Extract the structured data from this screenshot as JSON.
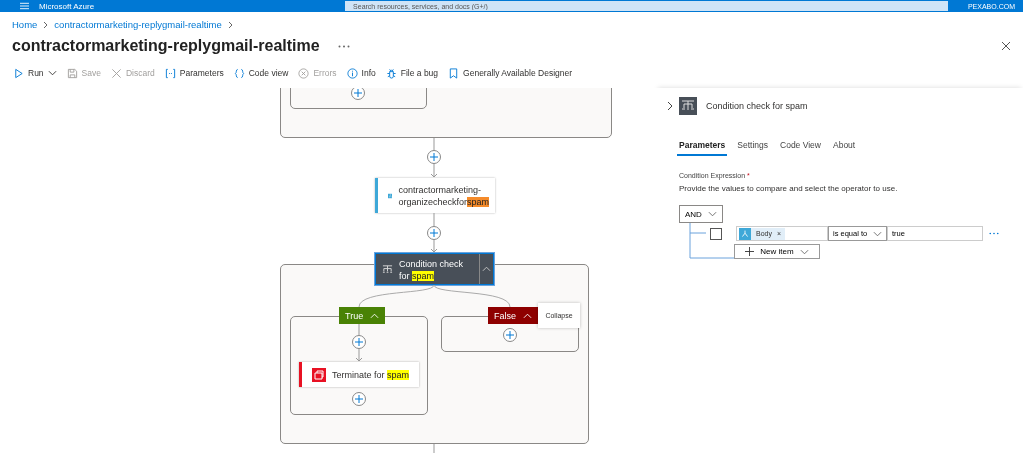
{
  "top_bar": {
    "brand": "Microsoft Azure",
    "search": {
      "placeholder": "Search resources, services, and docs (G+/)"
    },
    "account": "PEXABO.COM"
  },
  "breadcrumb": [
    {
      "label": "Home"
    },
    {
      "label": "contractormarketing-replygmail-realtime"
    }
  ],
  "title": "contractormarketing-replygmail-realtime",
  "toolbar": [
    {
      "label": "Run",
      "kind": "play",
      "disabled": false,
      "has_menu": true
    },
    {
      "label": "Save",
      "kind": "save",
      "disabled": true,
      "has_menu": false
    },
    {
      "label": "Discard",
      "kind": "discard",
      "disabled": true,
      "has_menu": false
    },
    {
      "label": "Parameters",
      "kind": "parameters",
      "disabled": false,
      "has_menu": false
    },
    {
      "label": "Code view",
      "kind": "code",
      "disabled": false,
      "has_menu": false
    },
    {
      "label": "Errors",
      "kind": "errors",
      "disabled": true,
      "has_menu": false
    },
    {
      "label": "Info",
      "kind": "info",
      "disabled": false,
      "has_menu": false
    },
    {
      "label": "File a bug",
      "kind": "bug",
      "disabled": false,
      "has_menu": false
    },
    {
      "label": "Generally Available Designer",
      "kind": "bookmark",
      "disabled": false,
      "has_menu": false
    }
  ],
  "canvas": {
    "action": {
      "text": "contractormarketing-organizecheckfor",
      "highlight": "spam",
      "match_active": true
    },
    "condition": {
      "text": "Condition check for ",
      "highlight": "spam",
      "match_active": false,
      "selected": true
    },
    "branches": [
      {
        "label": "True",
        "kind": "true",
        "expanded": true
      },
      {
        "label": "False",
        "kind": "false",
        "expanded": true
      }
    ],
    "terminate": {
      "text": "Terminate for ",
      "highlight": "spam",
      "match_active": false
    },
    "tooltip": "Collapse"
  },
  "panel": {
    "title": "Condition check for spam",
    "tabs": [
      {
        "label": "Parameters",
        "selected": true
      },
      {
        "label": "Settings",
        "selected": false
      },
      {
        "label": "Code View",
        "selected": false
      },
      {
        "label": "About",
        "selected": false
      }
    ],
    "field_label": "Condition Expression",
    "required_marker": "*",
    "description": "Provide the values to compare and select the operator to use.",
    "group": {
      "operator": "AND",
      "rows": [
        {
          "checked": false,
          "token": "Body",
          "token_remove": "×",
          "comparison": "is equal to",
          "value": "true"
        }
      ],
      "add_button": "New item"
    }
  }
}
